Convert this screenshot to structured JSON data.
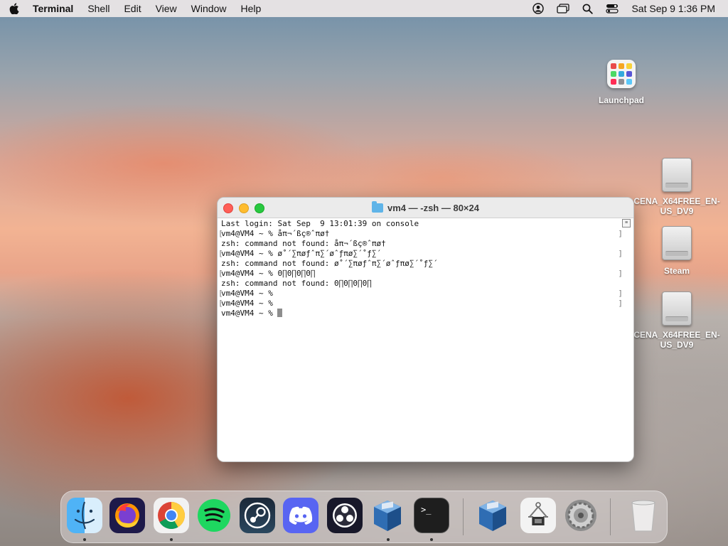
{
  "menubar": {
    "app_name": "Terminal",
    "menus": [
      "Shell",
      "Edit",
      "View",
      "Window",
      "Help"
    ],
    "clock": "Sat Sep 9  1:36 PM"
  },
  "desktop": {
    "icons": [
      {
        "label": "Launchpad"
      },
      {
        "label": "CENA_X64FREE_EN-US_DV9"
      },
      {
        "label": "Steam"
      },
      {
        "label": "CENA_X64FREE_EN-US_DV9"
      }
    ]
  },
  "terminal": {
    "title": "vm4 — -zsh — 80×24",
    "lines": [
      "Last login: Sat Sep  9 13:01:39 on console",
      "vm4@VM4 ~ % åπ¬´ßç®ˆπø†",
      "zsh: command not found: åπ¬´ßç®ˆπø†",
      "vm4@VM4 ~ % ø˚´∑πøƒˆπ∑´øˆƒπø∑´˚ƒ∑´",
      "zsh: command not found: ø˚´∑πøƒˆπ∑´øˆƒπø∑´˚ƒ∑´",
      "vm4@VM4 ~ % 0∏0∏0∏0∏",
      "zsh: command not found: 0∏0∏0∏0∏",
      "vm4@VM4 ~ %",
      "vm4@VM4 ~ %",
      "vm4@VM4 ~ % "
    ]
  },
  "dock": {
    "apps": [
      "Finder",
      "Firefox",
      "Google Chrome",
      "Spotify",
      "Steam",
      "Discord",
      "OBS",
      "VirtualBox",
      "Terminal",
      "VirtualBox",
      "System Information",
      "System Settings",
      "Trash"
    ]
  }
}
